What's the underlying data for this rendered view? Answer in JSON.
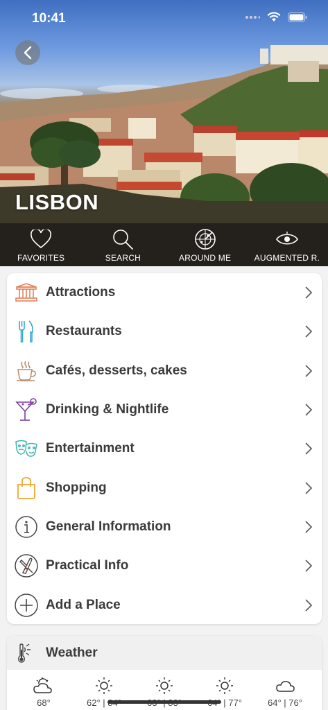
{
  "status_bar": {
    "time": "10:41"
  },
  "hero": {
    "city": "LISBON"
  },
  "toolbar": {
    "items": [
      {
        "label": "FAVORITES",
        "icon": "heart-icon"
      },
      {
        "label": "SEARCH",
        "icon": "search-icon"
      },
      {
        "label": "AROUND ME",
        "icon": "radar-icon"
      },
      {
        "label": "AUGMENTED R.",
        "icon": "eye-icon"
      }
    ]
  },
  "menu": {
    "items": [
      {
        "label": "Attractions",
        "icon": "monument-icon",
        "color": "#e07a4f"
      },
      {
        "label": "Restaurants",
        "icon": "fork-knife-icon",
        "color": "#3aa6cf"
      },
      {
        "label": "Cafés, desserts, cakes",
        "icon": "coffee-cup-icon",
        "color": "#b88a6a"
      },
      {
        "label": "Drinking & Nightlife",
        "icon": "cocktail-icon",
        "color": "#7a3fa0"
      },
      {
        "label": "Entertainment",
        "icon": "theater-masks-icon",
        "color": "#3fb5ad"
      },
      {
        "label": "Shopping",
        "icon": "shopping-bag-icon",
        "color": "#f0a830"
      },
      {
        "label": "General Information",
        "icon": "info-icon",
        "color": "#444444"
      },
      {
        "label": "Practical Info",
        "icon": "swiss-knife-icon",
        "color": "#444444"
      },
      {
        "label": "Add a Place",
        "icon": "plus-icon",
        "color": "#444444"
      }
    ]
  },
  "weather": {
    "title": "Weather",
    "days": [
      {
        "icon": "partly-cloudy-icon",
        "temp": "68°"
      },
      {
        "icon": "sun-icon",
        "temp": "62° | 84°"
      },
      {
        "icon": "sun-icon",
        "temp": "63° | 83°"
      },
      {
        "icon": "sun-icon",
        "temp": "64° | 77°"
      },
      {
        "icon": "cloud-icon",
        "temp": "64° | 76°"
      }
    ]
  }
}
